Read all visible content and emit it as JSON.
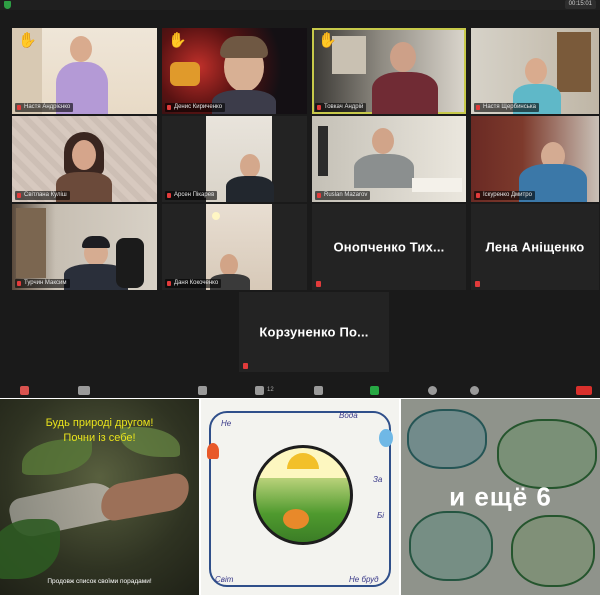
{
  "zoom": {
    "timer": "00:15:01",
    "participants": [
      {
        "name": "Настя Андрієнко",
        "hand": true
      },
      {
        "name": "Денис Кириченко",
        "hand": true
      },
      {
        "name": "Товкач Андрій",
        "hand": true,
        "active": true
      },
      {
        "name": "Настя Щербинська",
        "hand": false
      },
      {
        "name": "Світлана Куліш",
        "hand": false
      },
      {
        "name": "Арсен Пікарев",
        "hand": false
      },
      {
        "name": "Ruslan Mazarov",
        "hand": false
      },
      {
        "name": "Іскуренко Дмитро",
        "hand": false
      },
      {
        "name": "Турчин Максим",
        "hand": false
      },
      {
        "name": "Даня Кокоченко",
        "hand": false
      },
      {
        "name": "Онопченко Тих...",
        "video": false
      },
      {
        "name": "Лена Аніщенко",
        "video": false
      },
      {
        "name": "Корзуненко По...",
        "video": false
      }
    ],
    "toolbar": {
      "participants_count": "12"
    },
    "colors": {
      "active_border": "#c7c94a",
      "mic_muted": "#e23b3b",
      "hand": "#f2c230"
    }
  },
  "thumbs": {
    "poster_line1": "Будь природі другом!",
    "poster_line2": "Почни із себе!",
    "poster_caption": "Продовж список своїми порадами!",
    "drawing_words": [
      "Вода",
      "За",
      "Не",
      "Бі",
      "Світ",
      "Не бруд"
    ],
    "more_label": "и ещё 6"
  }
}
